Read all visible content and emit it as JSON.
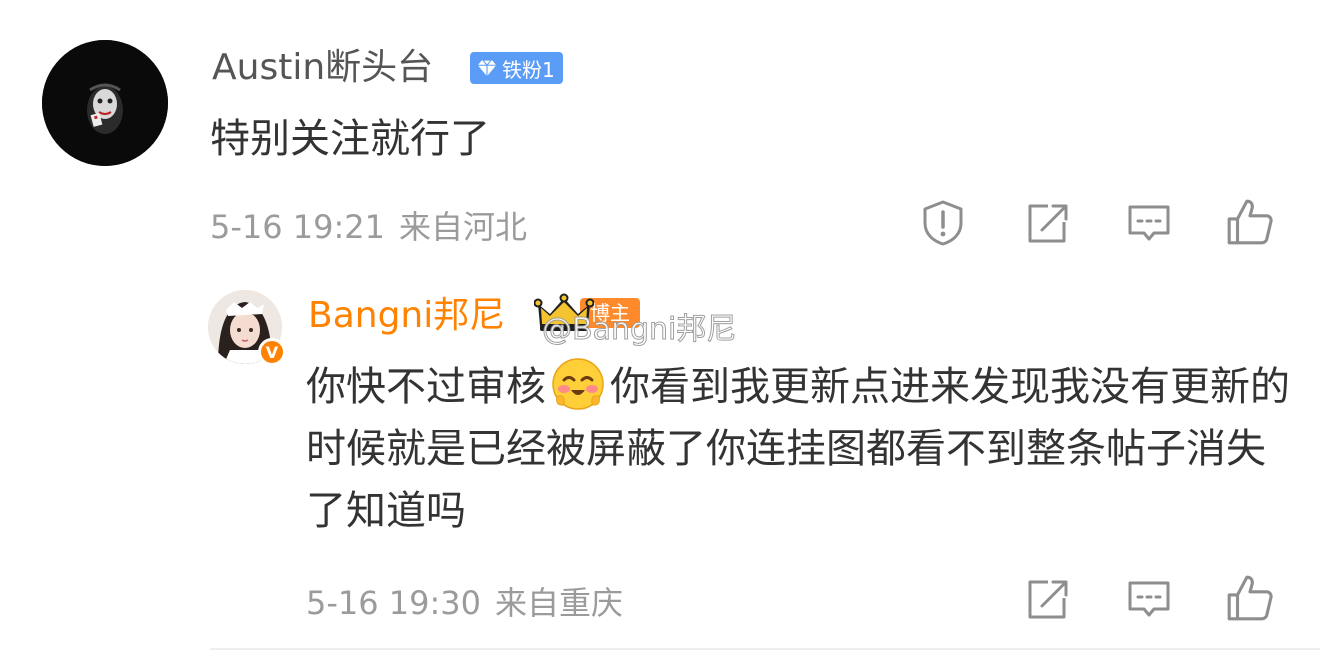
{
  "comment": {
    "author": "Austin断头台",
    "fan_badge": "铁粉1",
    "text": "特别关注就行了",
    "time": "5-16 19:21",
    "location": "来自河北"
  },
  "reply": {
    "author": "Bangni邦尼",
    "owner_badge": "博主",
    "watermark": "@Bangni邦尼",
    "text_part1": "你快不过审核",
    "text_part2": "你看到我更新点进来发现我没有更新的时候就是已经被屏蔽了你连挂图都看不到整条帖子消失了知道吗",
    "time": "5-16 19:30",
    "location": "来自重庆"
  },
  "icons": {
    "report": "report-icon",
    "repost": "repost-icon",
    "reply": "comment-icon",
    "like": "like-icon",
    "emoji": "smiling-blush-emoji",
    "verified": "verified-v-icon"
  },
  "colors": {
    "name": "#555555",
    "owner_name": "#ff8200",
    "fan_badge": "#5b9cf7",
    "meta": "#9b9b9b",
    "icon": "#8e8e8e"
  }
}
